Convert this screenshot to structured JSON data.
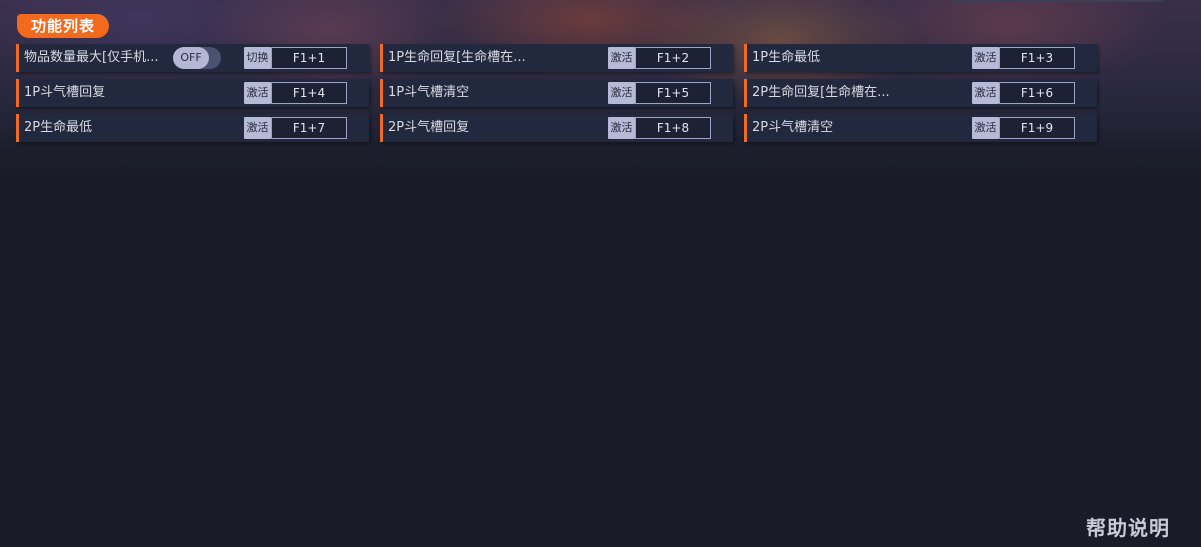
{
  "section_title": "功能列表",
  "help_label": "帮助说明",
  "toggle_state": "OFF",
  "features": [
    {
      "name": "物品数量最大[仅手机...",
      "action": "切换",
      "hotkey": "F1+1"
    },
    {
      "name": "1P生命回复[生命槽在...",
      "action": "激活",
      "hotkey": "F1+2"
    },
    {
      "name": "1P生命最低",
      "action": "激活",
      "hotkey": "F1+3"
    },
    {
      "name": "1P斗气槽回复",
      "action": "激活",
      "hotkey": "F1+4"
    },
    {
      "name": "1P斗气槽清空",
      "action": "激活",
      "hotkey": "F1+5"
    },
    {
      "name": "2P生命回复[生命槽在...",
      "action": "激活",
      "hotkey": "F1+6"
    },
    {
      "name": "2P生命最低",
      "action": "激活",
      "hotkey": "F1+7"
    },
    {
      "name": "2P斗气槽回复",
      "action": "激活",
      "hotkey": "F1+8"
    },
    {
      "name": "2P斗气槽清空",
      "action": "激活",
      "hotkey": "F1+9"
    }
  ],
  "colors": {
    "accent": "#f26a1e",
    "background": "#191c28",
    "row_background": "#22283d",
    "action_button": "#b7bad6"
  }
}
